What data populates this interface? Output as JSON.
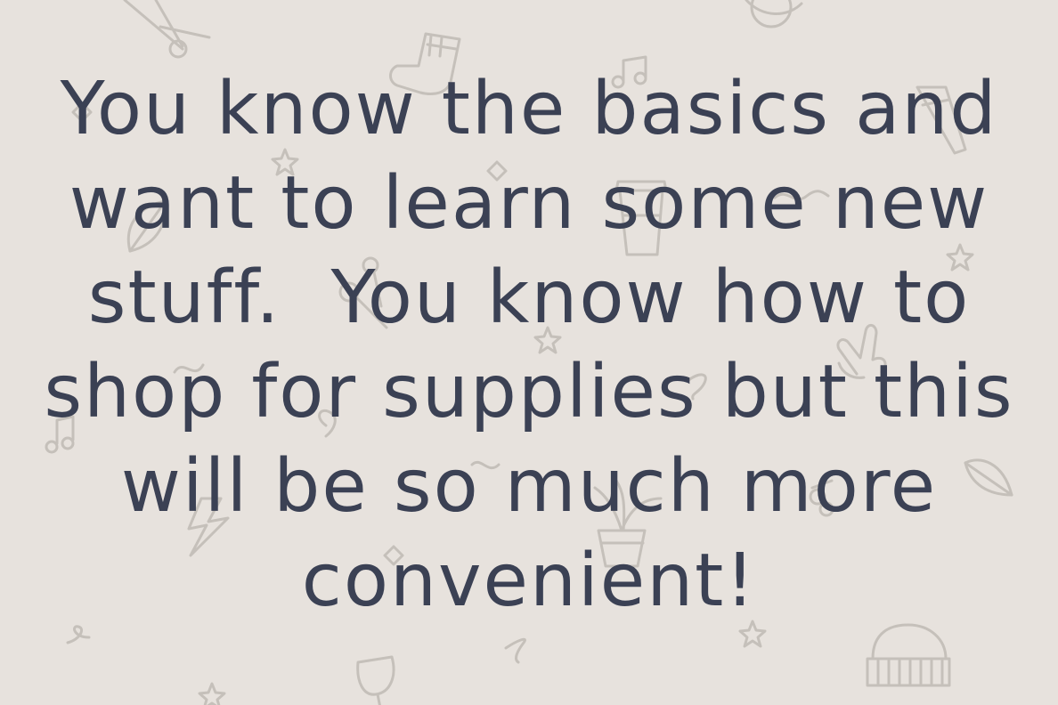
{
  "colors": {
    "background": "#e7e2dd",
    "text": "#3b4154",
    "doodle_stroke": "#c5c0ba"
  },
  "doodles": [
    "scissors-icon",
    "sock-icon",
    "music-note-icon",
    "planet-icon",
    "diamond-icon",
    "star-icon",
    "leaf-icon",
    "coffee-cup-icon",
    "squiggle-icon",
    "key-icon",
    "peace-hand-icon",
    "lightning-bolt-icon",
    "plant-pot-icon",
    "wine-glass-icon",
    "beanie-hat-icon",
    "pencil-icon"
  ],
  "message": {
    "lines": [
      "You know the basics and",
      "want to learn some new",
      "stuff.  You know how to",
      "shop for supplies but this",
      "will be so much more",
      "convenient!"
    ]
  }
}
